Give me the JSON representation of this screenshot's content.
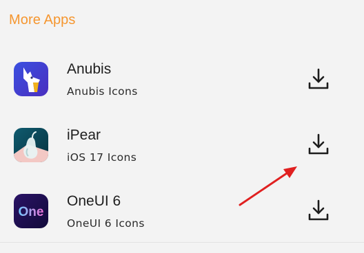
{
  "section": {
    "title": "More Apps"
  },
  "apps": [
    {
      "name": "Anubis",
      "subtitle": "Anubis Icons",
      "icon": "anubis-app-icon",
      "action_icon": "download-icon"
    },
    {
      "name": "iPear",
      "subtitle": "iOS 17 Icons",
      "icon": "ipear-app-icon",
      "action_icon": "download-icon"
    },
    {
      "name": "OneUI 6",
      "subtitle": "OneUI 6 Icons",
      "icon": "oneui-app-icon",
      "icon_text": "One",
      "action_icon": "download-icon"
    }
  ],
  "colors": {
    "accent": "#f5962f",
    "annotation": "#e02020",
    "background": "#f3f3f3"
  }
}
